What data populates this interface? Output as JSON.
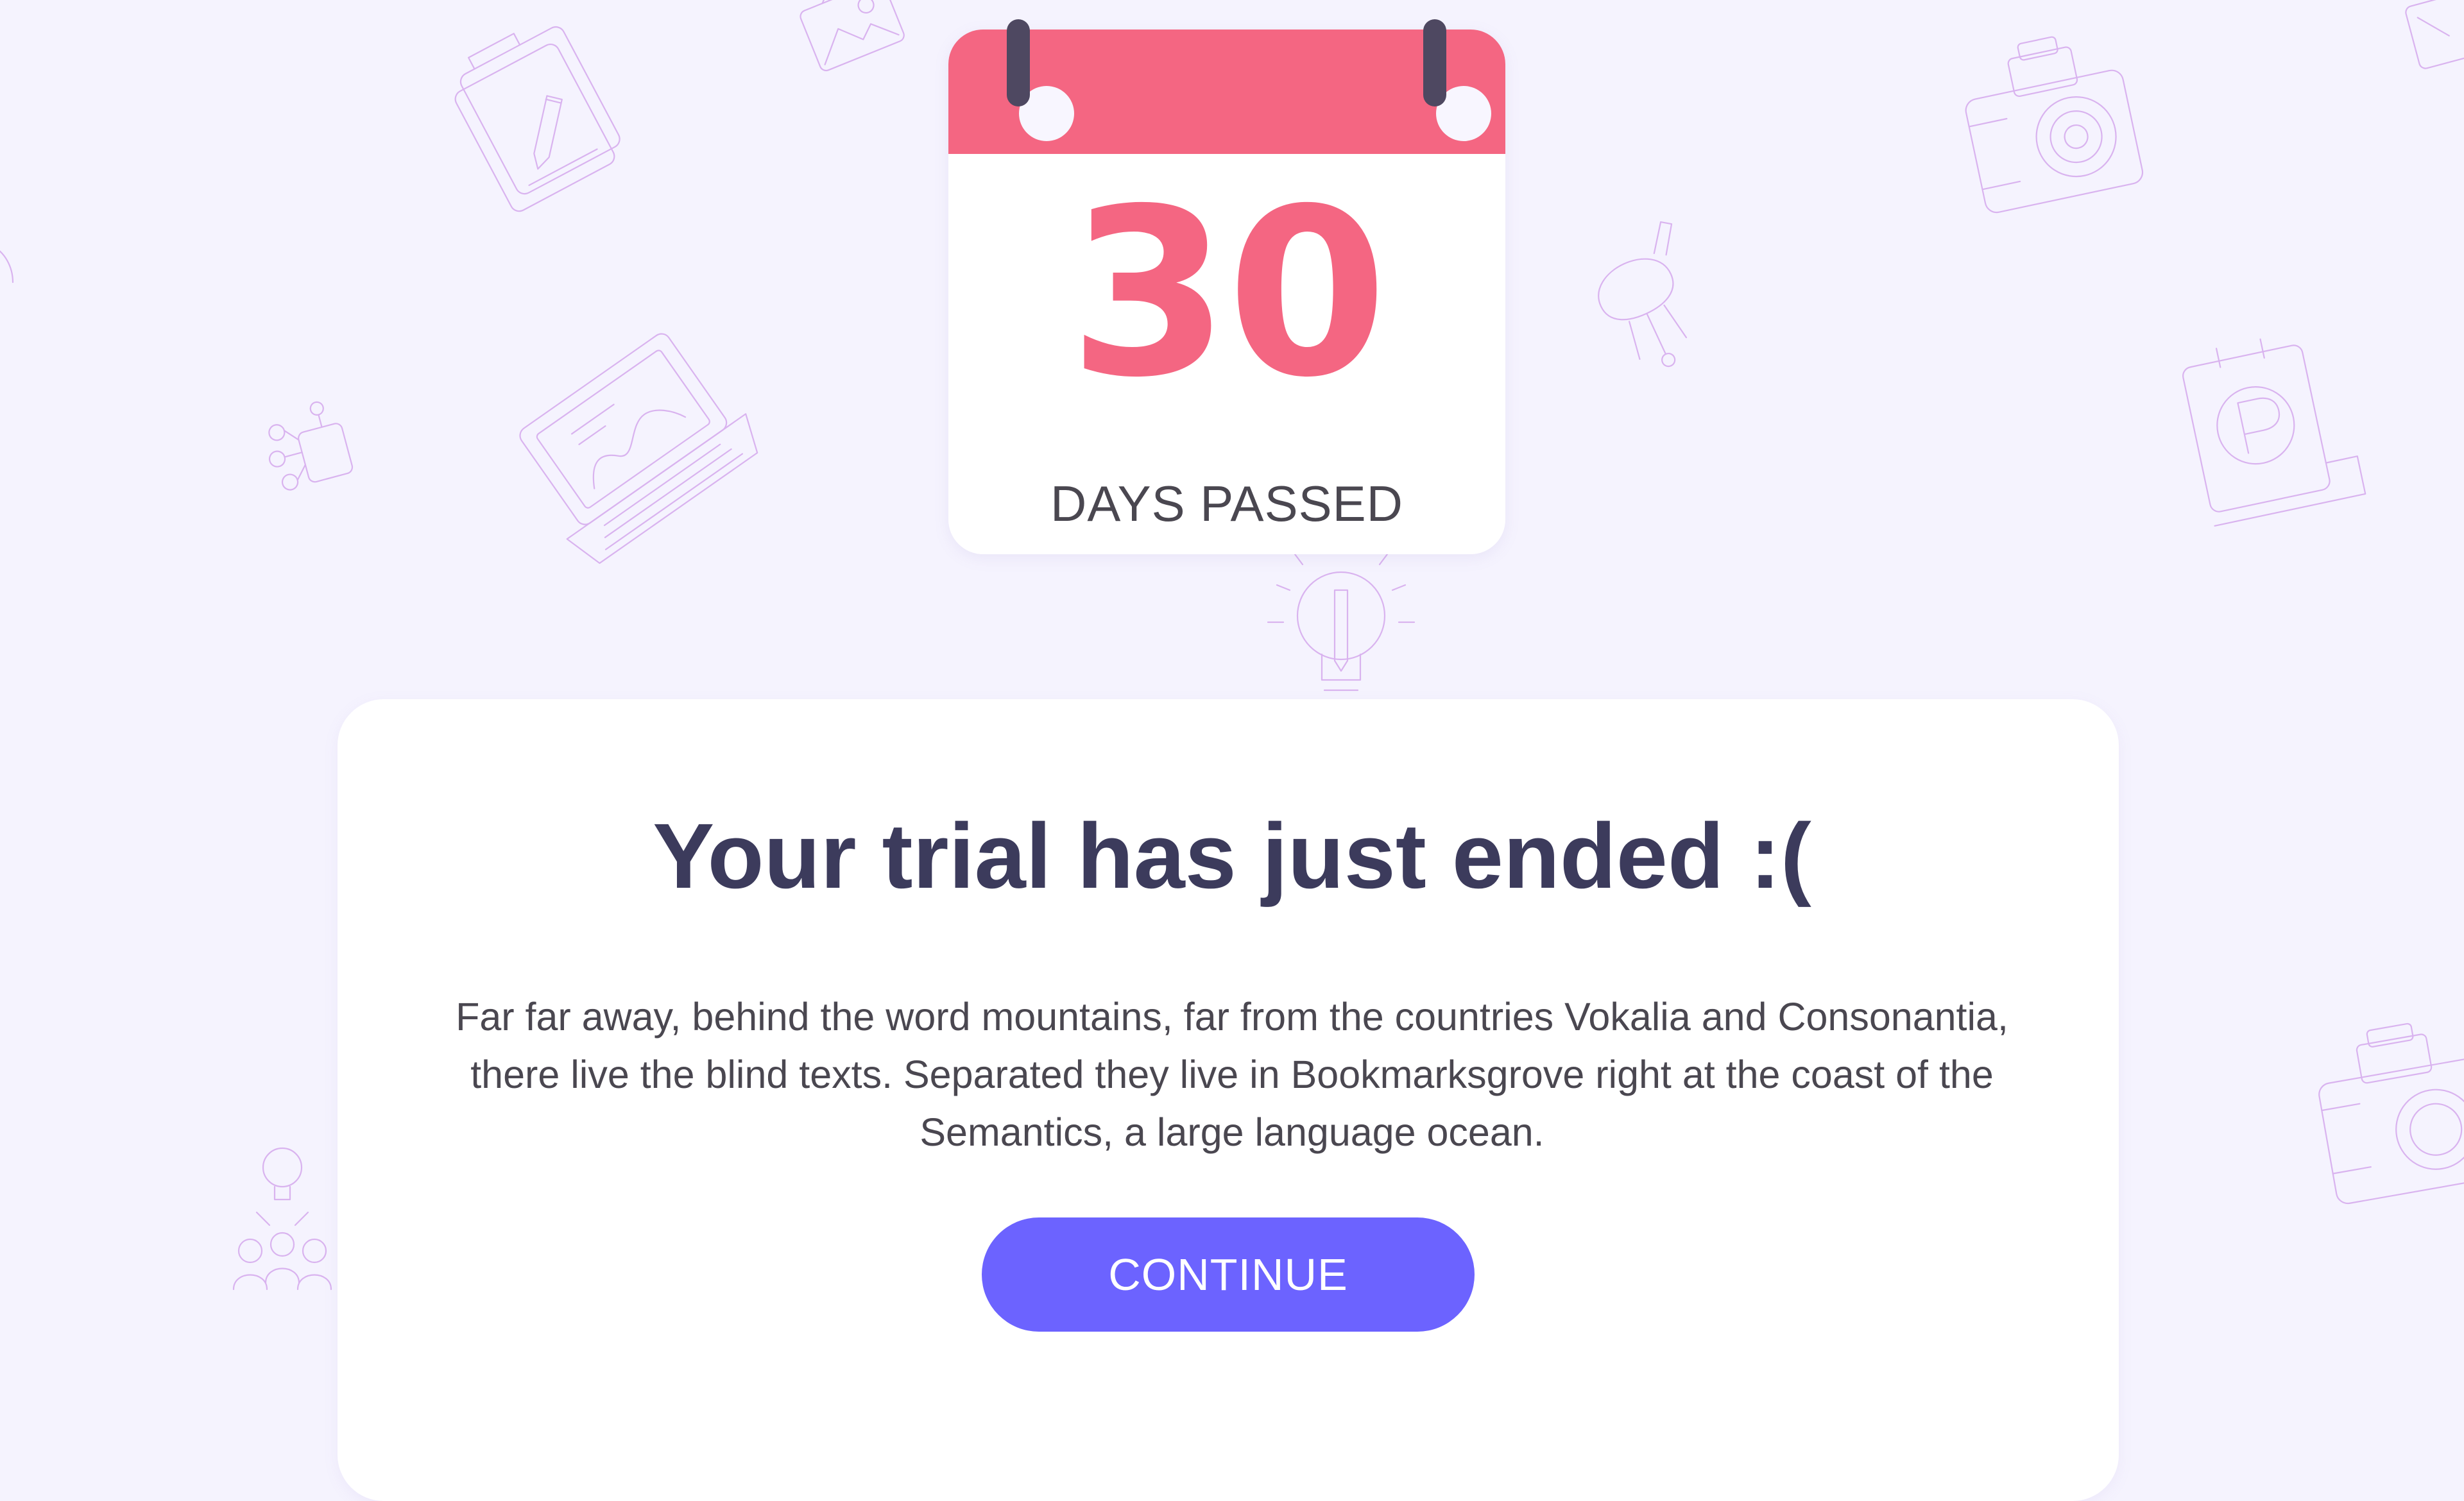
{
  "calendar": {
    "day_count": "30",
    "label": "DAYS PASSED",
    "header_color": "#f46682",
    "number_color": "#f46682"
  },
  "trial": {
    "title": "Your trial has just ended :(",
    "body": "Far far away, behind the word mountains, far from the countries Vokalia and Consonantia, there live the blind texts. Separated they live in Bookmarksgrove right at the coast of the Semantics, a large language ocean.",
    "continue_label": "CONTINUE",
    "button_color": "#6c63ff"
  },
  "background": {
    "color": "#f5f3fe",
    "icons": [
      "folder-pencil-icon",
      "image-icon",
      "camera-icon",
      "paintbrush-icon",
      "laptop-icon",
      "network-icon",
      "lightbulb-pencil-icon",
      "parking-sign-icon",
      "team-idea-icon"
    ]
  }
}
